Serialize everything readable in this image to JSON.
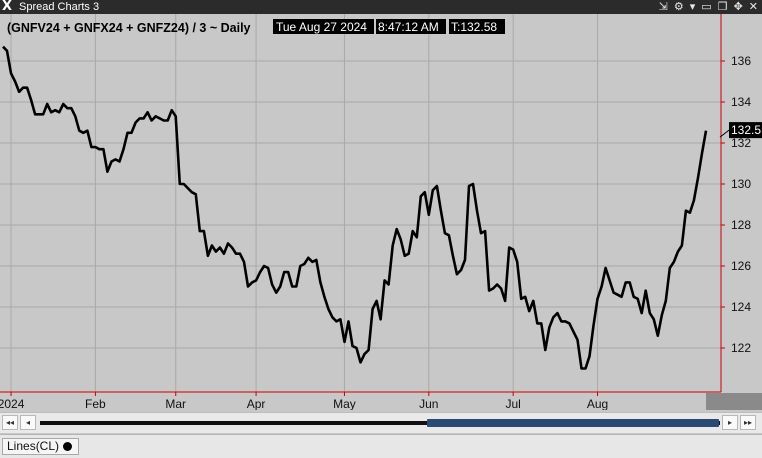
{
  "window": {
    "title": "Spread Charts 3",
    "logo": "X"
  },
  "titlebar_icons": [
    {
      "name": "expand-in-icon",
      "glyph": "⇲"
    },
    {
      "name": "settings-icon",
      "glyph": "⚙"
    },
    {
      "name": "dropdown-icon",
      "glyph": "▾"
    },
    {
      "name": "minimize-icon",
      "glyph": "▭"
    },
    {
      "name": "duplicate-icon",
      "glyph": "❐"
    },
    {
      "name": "pin-icon",
      "glyph": "✥"
    },
    {
      "name": "close-icon",
      "glyph": "✕"
    }
  ],
  "header": {
    "symbol": "(GNFV24 + GNFX24 + GNFZ24) / 3 ~ Daily",
    "datetime_date": "Tue Aug 27 2024",
    "datetime_time": "8:47:12 AM",
    "last": "T:132.58"
  },
  "price_tag": "132.5",
  "colors": {
    "background": "#c8c8c8",
    "grid": "#a9a9a9",
    "line": "#000000",
    "axis": "#cc0000",
    "tag": "#000000"
  },
  "chart_data": {
    "type": "line",
    "ylim": [
      120,
      138
    ],
    "y_ticks": [
      122,
      124,
      126,
      128,
      130,
      132,
      134,
      136
    ],
    "x_ticks": [
      "2024",
      "Feb",
      "Mar",
      "Apr",
      "May",
      "Jun",
      "Jul",
      "Aug"
    ],
    "x_tick_index": [
      2,
      23,
      43,
      63,
      85,
      106,
      127,
      148
    ],
    "last_value": 132.58,
    "series": [
      {
        "values": [
          136.7,
          136.5,
          135.4,
          135,
          134.5,
          134.7,
          134.7,
          134.1,
          133.4,
          133.4,
          133.4,
          133.9,
          133.5,
          133.6,
          133.5,
          133.9,
          133.7,
          133.7,
          133.3,
          132.6,
          132.5,
          132.6,
          131.8,
          131.8,
          131.7,
          131.7,
          130.6,
          131.1,
          131.2,
          131.1,
          131.7,
          132.5,
          132.5,
          133,
          133.2,
          133.2,
          133.5,
          133.1,
          133.3,
          133.2,
          133.1,
          133.1,
          133.6,
          133.3,
          130,
          130,
          129.8,
          129.6,
          129.5,
          127.7,
          127.7,
          126.5,
          127,
          126.7,
          126.9,
          126.6,
          127.1,
          126.9,
          126.6,
          126.6,
          126.2,
          125,
          125.2,
          125.3,
          125.7,
          126,
          125.9,
          125.1,
          124.7,
          125,
          125.7,
          125.7,
          125,
          125,
          126,
          126.1,
          126.4,
          126.2,
          126.3,
          125.2,
          124.5,
          123.9,
          123.5,
          123.3,
          123.4,
          122.3,
          123.3,
          122.1,
          122,
          121.3,
          121.7,
          121.9,
          123.9,
          124.3,
          123.4,
          125.3,
          125.1,
          127,
          127.8,
          127.3,
          126.5,
          126.6,
          127.7,
          127.4,
          129.4,
          129.6,
          128.5,
          129.7,
          129.9,
          128.7,
          127.6,
          127.5,
          126.5,
          125.6,
          125.8,
          126.3,
          129.9,
          130,
          128.7,
          127.6,
          127.7,
          124.8,
          124.9,
          125.1,
          124.9,
          124.3,
          126.9,
          126.8,
          126.2,
          124.4,
          124.5,
          123.8,
          124.3,
          123.2,
          123.2,
          121.9,
          123,
          123.5,
          123.7,
          123.3,
          123.3,
          123.2,
          122.8,
          122.4,
          121,
          121,
          121.6,
          123.1,
          124.4,
          125,
          125.9,
          125.3,
          124.7,
          124.6,
          124.5,
          125.2,
          125.2,
          124.5,
          124.4,
          123.7,
          124.8,
          123.7,
          123.4,
          122.6,
          123.6,
          124.3,
          125.9,
          126.2,
          126.7,
          127,
          128.7,
          128.6,
          129.2,
          130.3,
          131.5,
          132.6
        ]
      }
    ]
  },
  "scrollbar": {
    "left_end": "first-icon",
    "left": "left-arrow-icon",
    "right": "right-arrow-icon",
    "right_end": "last-icon",
    "position": 0.57
  },
  "status": {
    "tab_label": "Lines(CL)"
  }
}
